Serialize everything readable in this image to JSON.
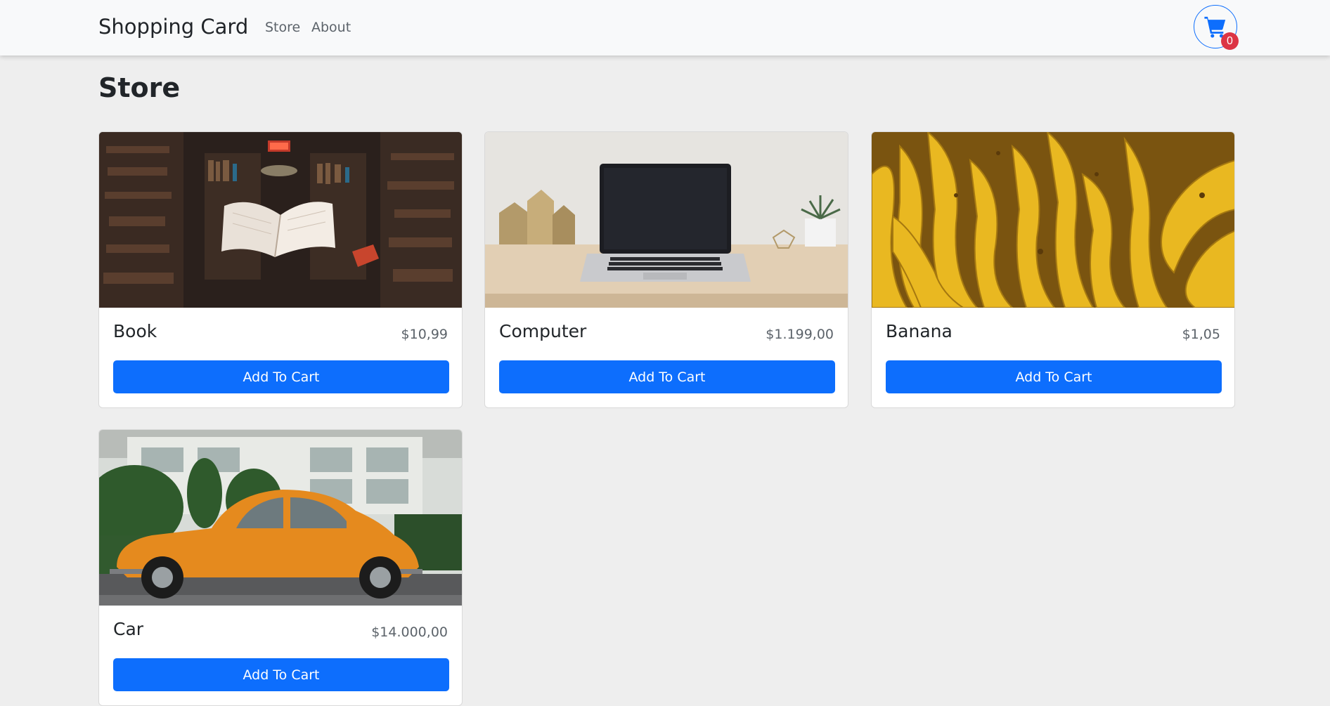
{
  "navbar": {
    "brand": "Shopping Card",
    "links": [
      "Store",
      "About"
    ],
    "cart_icon": "shopping-cart-icon",
    "cart_count": "0"
  },
  "page": {
    "title": "Store"
  },
  "products": [
    {
      "name": "Book",
      "price": "$10,99",
      "button": "Add To Cart",
      "image": "floating-book-library"
    },
    {
      "name": "Computer",
      "price": "$1.199,00",
      "button": "Add To Cart",
      "image": "laptop-on-desk"
    },
    {
      "name": "Banana",
      "price": "$1,05",
      "button": "Add To Cart",
      "image": "banana-bunches"
    },
    {
      "name": "Car",
      "price": "$14.000,00",
      "button": "Add To Cart",
      "image": "orange-beetle-car"
    }
  ],
  "colors": {
    "primary": "#0d6efd",
    "badge": "#dc3545",
    "navbar_bg": "#f8f9fa",
    "page_bg": "#eeeeee"
  }
}
